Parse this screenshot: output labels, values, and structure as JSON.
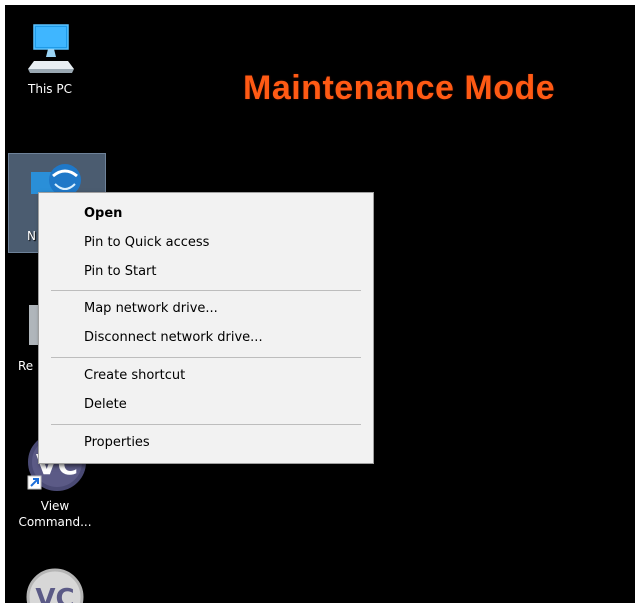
{
  "desktop": {
    "background": "#000000",
    "banner": {
      "text": "Maintenance Mode",
      "color": "#ff5a14"
    },
    "icons": [
      {
        "label": "This PC",
        "icon": "computer-icon"
      },
      {
        "label": "N",
        "icon": "network-icon",
        "selected": true
      },
      {
        "label": "Re",
        "icon": "recycle-bin-icon"
      },
      {
        "label": "View Command...",
        "icon": "vc-icon",
        "shortcut": true
      },
      {
        "label": "",
        "icon": "vc-icon"
      }
    ]
  },
  "context_menu": {
    "groups": [
      [
        "Open",
        "Pin to Quick access",
        "Pin to Start"
      ],
      [
        "Map network drive...",
        "Disconnect network drive..."
      ],
      [
        "Create shortcut",
        "Delete"
      ],
      [
        "Properties"
      ]
    ],
    "default_item": "Open"
  }
}
